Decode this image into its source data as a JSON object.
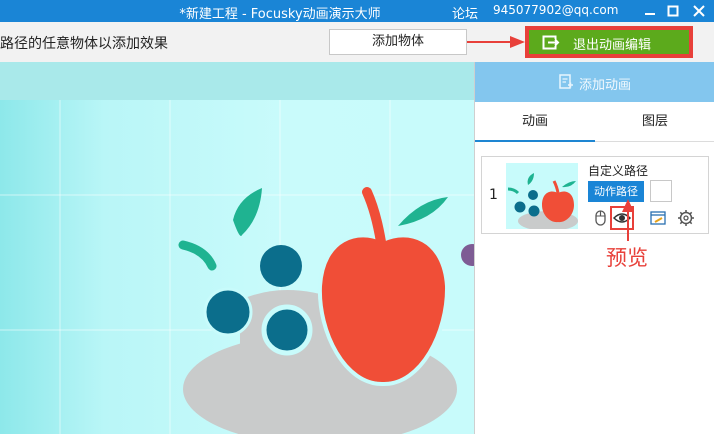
{
  "window": {
    "title": "*新建工程 - Focusky动画演示大师",
    "forum": "论坛",
    "account": "945077902@qq.com",
    "controls": [
      "minimize-icon",
      "maximize-icon",
      "close-icon"
    ]
  },
  "toolbar": {
    "hint": "路径的任意物体以添加效果",
    "add_object_label": "添加物体",
    "exit_label": "退出动画编辑",
    "exit_icon": "exit-icon"
  },
  "panel": {
    "add_animation_label": "添加动画",
    "tabs": [
      {
        "label": "动画",
        "active": true
      },
      {
        "label": "图层",
        "active": false
      }
    ],
    "items": [
      {
        "index": "1",
        "title": "自定义路径",
        "action_label": "动作路径",
        "tools": [
          "mouse-icon",
          "eye-icon",
          "note-icon",
          "gear-icon"
        ]
      }
    ],
    "annotation": "预览"
  },
  "colors": {
    "titlebar": "#1a85d6",
    "exit_button": "#5caa1c",
    "highlight": "#e8403a",
    "add_animation": "#83c6ee",
    "apple": "#f04e37",
    "leaf": "#1fb391",
    "berry": "#0b6e8c",
    "bowl": "#c9cbcb"
  }
}
